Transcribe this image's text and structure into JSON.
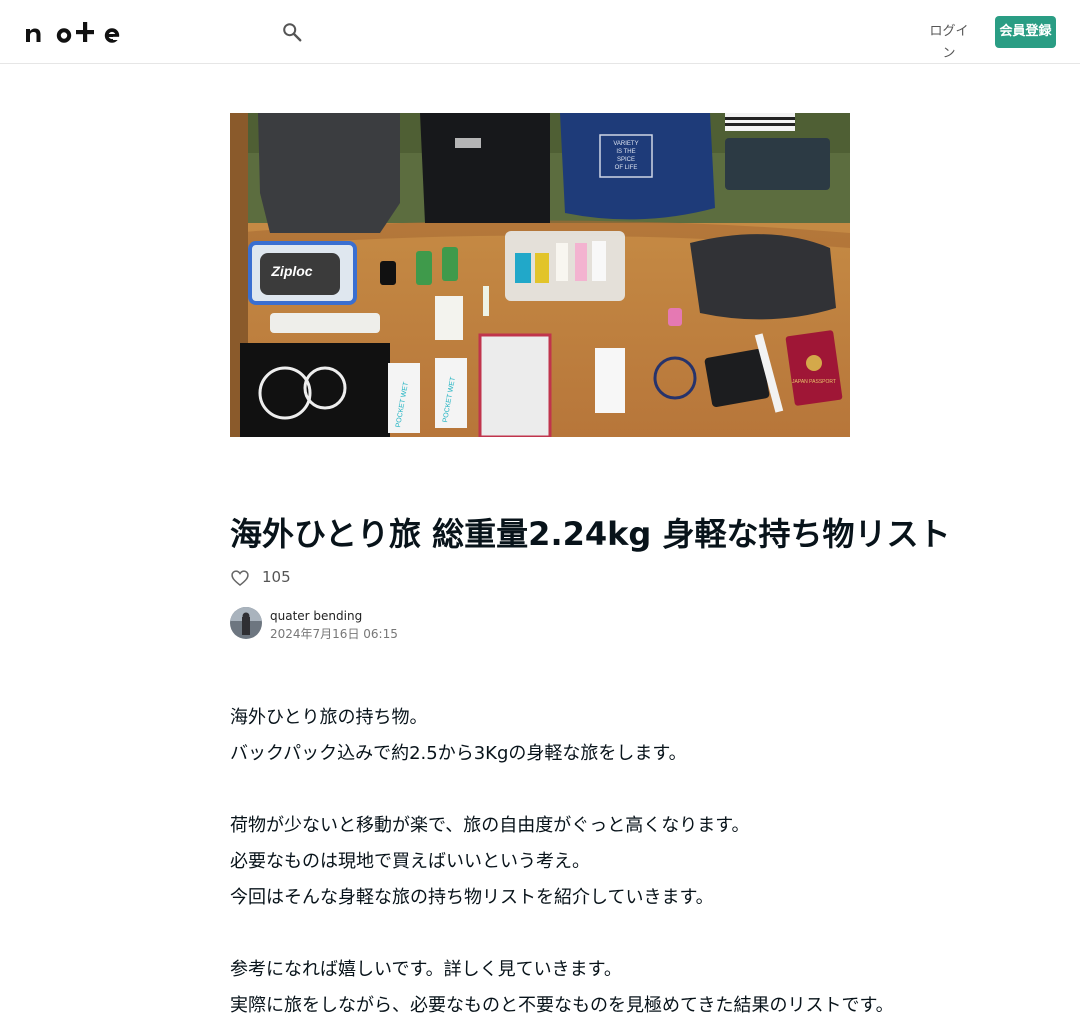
{
  "header": {
    "logo_text": "note",
    "search_icon": "search-icon",
    "login_label": "ログイン",
    "register_label": "会員登録",
    "accent_color": "#2a9d84"
  },
  "hero_image": {
    "description_icon": "travel-packing-photo",
    "bag_brand_text": "Ziploc",
    "bag_print_lines": [
      "VARIETY",
      "IS THE",
      "SPICE",
      "OF LIFE"
    ],
    "wipes_text": "POCKET WET",
    "passport_text": "JAPAN PASSPORT"
  },
  "article": {
    "title": "海外ひとり旅 総重量2.24kg 身軽な持ち物リスト",
    "like_count": "105",
    "author_name": "quater bending",
    "post_date": "2024年7月16日 06:15",
    "paragraphs": [
      "海外ひとり旅の持ち物。",
      "バックパック込みで約2.5から3Kgの身軽な旅をします。",
      "",
      "荷物が少ないと移動が楽で、旅の自由度がぐっと高くなります。",
      "必要なものは現地で買えばいいという考え。",
      "今回はそんな身軽な旅の持ち物リストを紹介していきます。",
      "",
      "参考になれば嬉しいです。詳しく見ていきます。",
      "実際に旅をしながら、必要なものと不要なものを見極めてきた結果のリストです。"
    ]
  }
}
